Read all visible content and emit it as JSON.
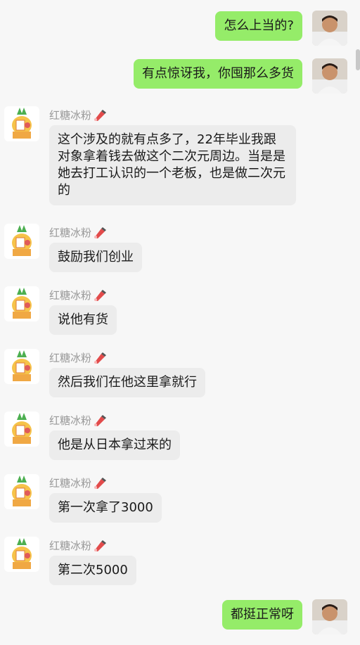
{
  "other_user": {
    "name": "红糖冰粉"
  },
  "messages": [
    {
      "side": "self",
      "text": "怎么上当的?"
    },
    {
      "side": "self",
      "text": "有点惊讶我，你囤那么多货"
    },
    {
      "side": "other",
      "text": "这个涉及的就有点多了，22年毕业我跟对象拿着钱去做这个二次元周边。当是是她去打工认识的一个老板，也是做二次元的"
    },
    {
      "side": "other",
      "text": "鼓励我们创业"
    },
    {
      "side": "other",
      "text": "说他有货"
    },
    {
      "side": "other",
      "text": "然后我们在他这里拿就行"
    },
    {
      "side": "other",
      "text": "他是从日本拿过来的"
    },
    {
      "side": "other",
      "text": "第一次拿了3000"
    },
    {
      "side": "other",
      "text": "第二次5000"
    },
    {
      "side": "self",
      "text": "都挺正常呀"
    }
  ],
  "icons": {
    "self_avatar": "user-photo-avatar",
    "other_avatar": "pineapple-cartoon-avatar",
    "badge": "pen-badge-icon"
  },
  "colors": {
    "self_bubble": "#95ec69",
    "other_bubble": "#ececec",
    "background": "#f7f7f7",
    "name": "#999999"
  }
}
